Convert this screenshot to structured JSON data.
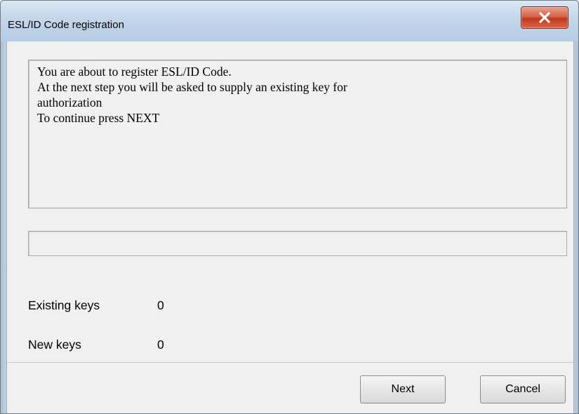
{
  "window": {
    "title": "ESL/ID Code registration"
  },
  "message": {
    "lines": [
      "You are about to register ESL/ID Code.",
      "At the next step you will be asked to supply an existing key for",
      "authorization",
      "To continue press NEXT"
    ]
  },
  "stats": {
    "existing_keys_label": "Existing keys",
    "existing_keys_value": "0",
    "new_keys_label": "New keys",
    "new_keys_value": "0"
  },
  "buttons": {
    "next_label": "Next",
    "cancel_label": "Cancel"
  },
  "icons": {
    "close": "close-icon"
  },
  "colors": {
    "close_button": "#c2391c",
    "titlebar": "#c3d6ea",
    "client_background": "#f0f0f0"
  }
}
